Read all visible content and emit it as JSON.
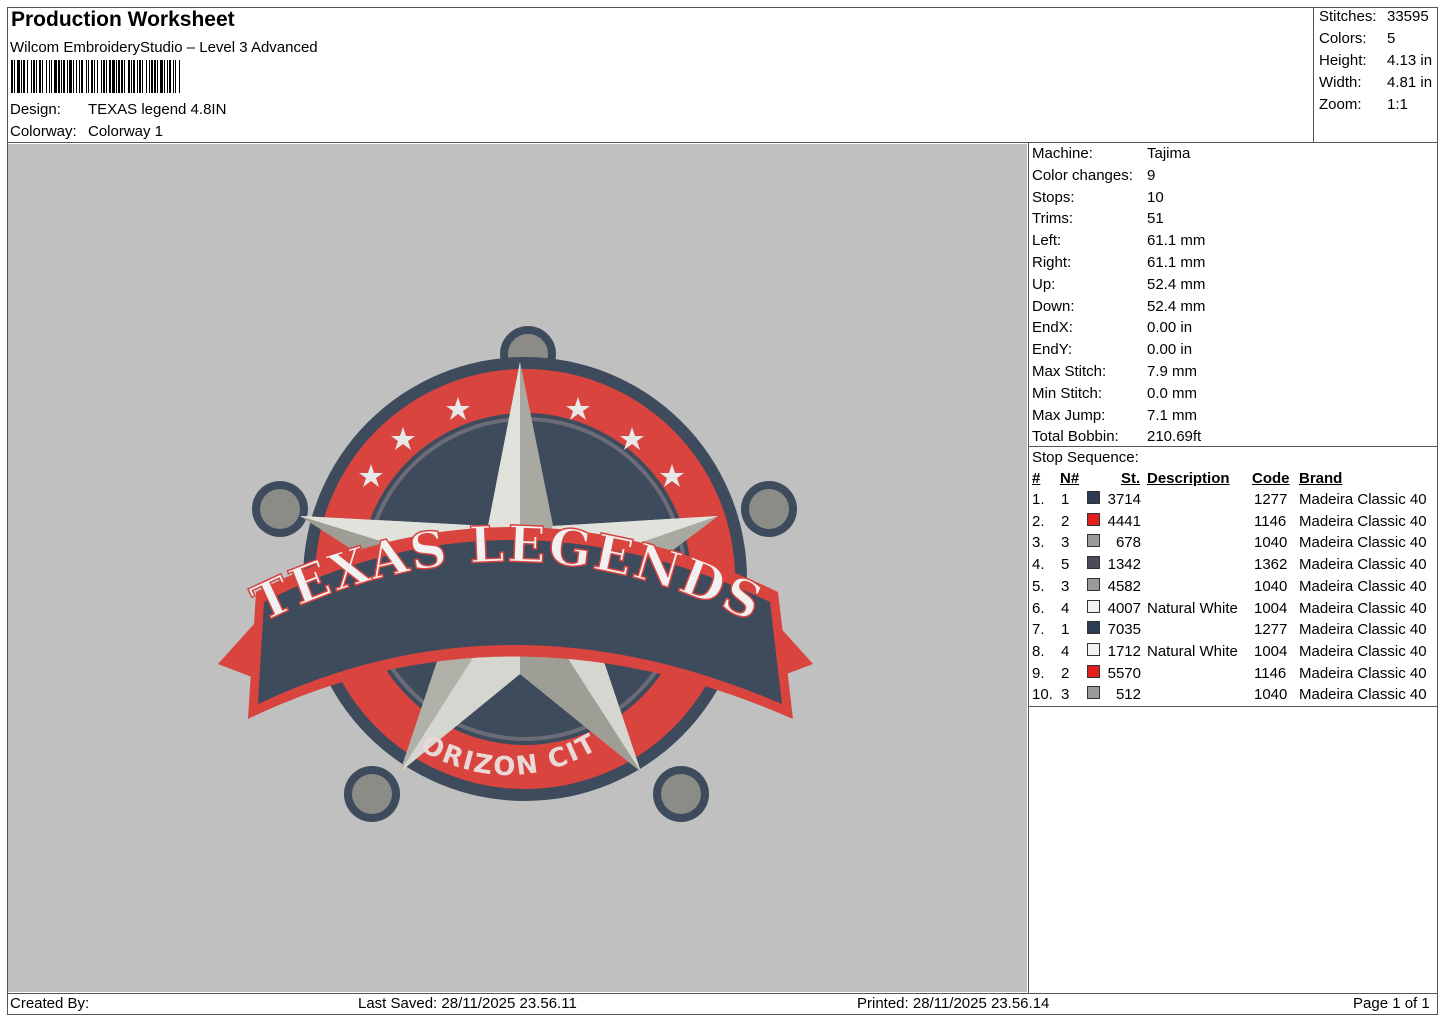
{
  "header": {
    "title": "Production Worksheet",
    "subtitle": "Wilcom EmbroideryStudio – Level 3 Advanced",
    "design_label": "Design:",
    "design_value": "TEXAS legend 4.8IN",
    "colorway_label": "Colorway:",
    "colorway_value": "Colorway 1"
  },
  "summary": [
    {
      "label": "Stitches:",
      "value": "33595"
    },
    {
      "label": "Colors:",
      "value": "5"
    },
    {
      "label": "Height:",
      "value": "4.13 in"
    },
    {
      "label": "Width:",
      "value": "4.81 in"
    },
    {
      "label": "Zoom:",
      "value": "1:1"
    }
  ],
  "machine_info": [
    {
      "label": "Machine:",
      "value": "Tajima"
    },
    {
      "label": "Color changes:",
      "value": "9"
    },
    {
      "label": "Stops:",
      "value": "10"
    },
    {
      "label": "Trims:",
      "value": "51"
    },
    {
      "label": "Left:",
      "value": "61.1 mm"
    },
    {
      "label": "Right:",
      "value": "61.1 mm"
    },
    {
      "label": "Up:",
      "value": "52.4 mm"
    },
    {
      "label": "Down:",
      "value": "52.4 mm"
    },
    {
      "label": "EndX:",
      "value": "0.00 in"
    },
    {
      "label": "EndY:",
      "value": "0.00 in"
    },
    {
      "label": "Max Stitch:",
      "value": "7.9 mm"
    },
    {
      "label": "Min Stitch:",
      "value": "0.0 mm"
    },
    {
      "label": "Max Jump:",
      "value": "7.1 mm"
    },
    {
      "label": "Total Bobbin:",
      "value": "210.69ft"
    }
  ],
  "stop_sequence": {
    "title": "Stop Sequence:",
    "columns": [
      "#",
      "N#",
      "St.",
      "Description",
      "Code",
      "Brand"
    ],
    "rows": [
      {
        "num": "1.",
        "n": "1",
        "color": "#2e3e52",
        "st": "3714",
        "desc": "",
        "code": "1277",
        "brand": "Madeira Classic 40"
      },
      {
        "num": "2.",
        "n": "2",
        "color": "#e02020",
        "st": "4441",
        "desc": "",
        "code": "1146",
        "brand": "Madeira Classic 40"
      },
      {
        "num": "3.",
        "n": "3",
        "color": "#9a9a9a",
        "st": "678",
        "desc": "",
        "code": "1040",
        "brand": "Madeira Classic 40"
      },
      {
        "num": "4.",
        "n": "5",
        "color": "#4a4a5a",
        "st": "1342",
        "desc": "",
        "code": "1362",
        "brand": "Madeira Classic 40"
      },
      {
        "num": "5.",
        "n": "3",
        "color": "#9a9a9a",
        "st": "4582",
        "desc": "",
        "code": "1040",
        "brand": "Madeira Classic 40"
      },
      {
        "num": "6.",
        "n": "4",
        "color": "#f2f2f2",
        "st": "4007",
        "desc": "Natural White",
        "code": "1004",
        "brand": "Madeira Classic 40"
      },
      {
        "num": "7.",
        "n": "1",
        "color": "#2e3e52",
        "st": "7035",
        "desc": "",
        "code": "1277",
        "brand": "Madeira Classic 40"
      },
      {
        "num": "8.",
        "n": "4",
        "color": "#f2f2f2",
        "st": "1712",
        "desc": "Natural White",
        "code": "1004",
        "brand": "Madeira Classic 40"
      },
      {
        "num": "9.",
        "n": "2",
        "color": "#e02020",
        "st": "5570",
        "desc": "",
        "code": "1146",
        "brand": "Madeira Classic 40"
      },
      {
        "num": "10.",
        "n": "3",
        "color": "#9a9a9a",
        "st": "512",
        "desc": "",
        "code": "1040",
        "brand": "Madeira Classic 40"
      }
    ]
  },
  "design_preview": {
    "banner_text": "TEXAS LEGENDS",
    "bottom_text": "HORIZON CITY",
    "colors": {
      "navy": "#3d4b5c",
      "red": "#d9443f",
      "silver": "#c9c9c2",
      "gray_dark": "#8c8c86",
      "background": "#c0c0c0"
    }
  },
  "footer": {
    "created_by": "Created By:",
    "last_saved": "Last Saved: 28/11/2025 23.56.11",
    "printed": "Printed: 28/11/2025 23.56.14",
    "page": "Page 1 of 1"
  }
}
